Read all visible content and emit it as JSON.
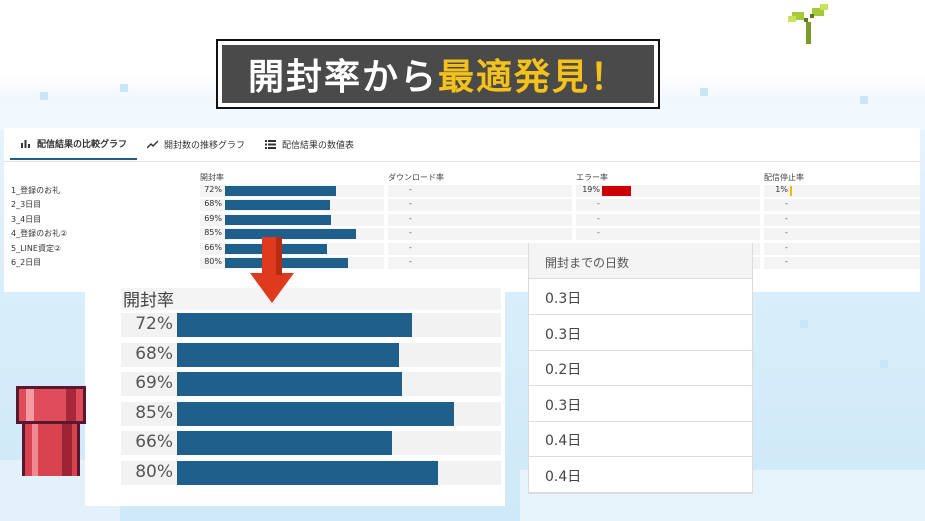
{
  "banner": {
    "part_white": "開封率から",
    "part_yellow": "最適発見！"
  },
  "tabs": [
    {
      "label": "配信結果の比較グラフ",
      "icon": "bar-chart-icon",
      "active": true
    },
    {
      "label": "開封数の推移グラフ",
      "icon": "line-chart-icon",
      "active": false
    },
    {
      "label": "配信結果の数値表",
      "icon": "table-icon",
      "active": false
    }
  ],
  "columns": {
    "open_rate": "開封率",
    "download_rate": "ダウンロード率",
    "error_rate": "エラー率",
    "stop_rate": "配信停止率"
  },
  "rows": [
    {
      "label": "1_登録のお礼",
      "open": "72%",
      "open_value": 72,
      "download": "-",
      "error": "19%",
      "error_value": 19,
      "stop": "1%",
      "stop_value": 1
    },
    {
      "label": "2_3日目",
      "open": "68%",
      "open_value": 68,
      "download": "-",
      "error": "-",
      "stop": "-"
    },
    {
      "label": "3_4日目",
      "open": "69%",
      "open_value": 69,
      "download": "-",
      "error": "-",
      "stop": "-"
    },
    {
      "label": "4_登録のお礼②",
      "open": "85%",
      "open_value": 85,
      "download": "-",
      "error": "-",
      "stop": "-"
    },
    {
      "label": "5_LINE資定②",
      "open": "66%",
      "open_value": 66,
      "download": "-",
      "error": "-",
      "stop": "-"
    },
    {
      "label": "6_2日目",
      "open": "80%",
      "open_value": 80,
      "download": "-",
      "error": "-",
      "stop": "-"
    }
  ],
  "zoom": {
    "title": "開封率",
    "rows": [
      {
        "pct": "72%",
        "value": 72
      },
      {
        "pct": "68%",
        "value": 68
      },
      {
        "pct": "69%",
        "value": 69
      },
      {
        "pct": "85%",
        "value": 85
      },
      {
        "pct": "66%",
        "value": 66
      },
      {
        "pct": "80%",
        "value": 80
      }
    ]
  },
  "days_table": {
    "header": "開封までの日数",
    "values": [
      "0.3日",
      "0.3日",
      "0.2日",
      "0.3日",
      "0.4日",
      "0.4日"
    ]
  },
  "colors": {
    "bar": "#1f5f8b",
    "error_bar": "#cc0000",
    "stop_bar": "#f2b705",
    "banner_bg": "#4a4a4a",
    "banner_yellow": "#f6c21a",
    "arrow": "#e03a1e"
  },
  "icons": {
    "arrow": "down-arrow-icon",
    "sprout": "sprout-icon",
    "pipe": "pipe-icon"
  }
}
